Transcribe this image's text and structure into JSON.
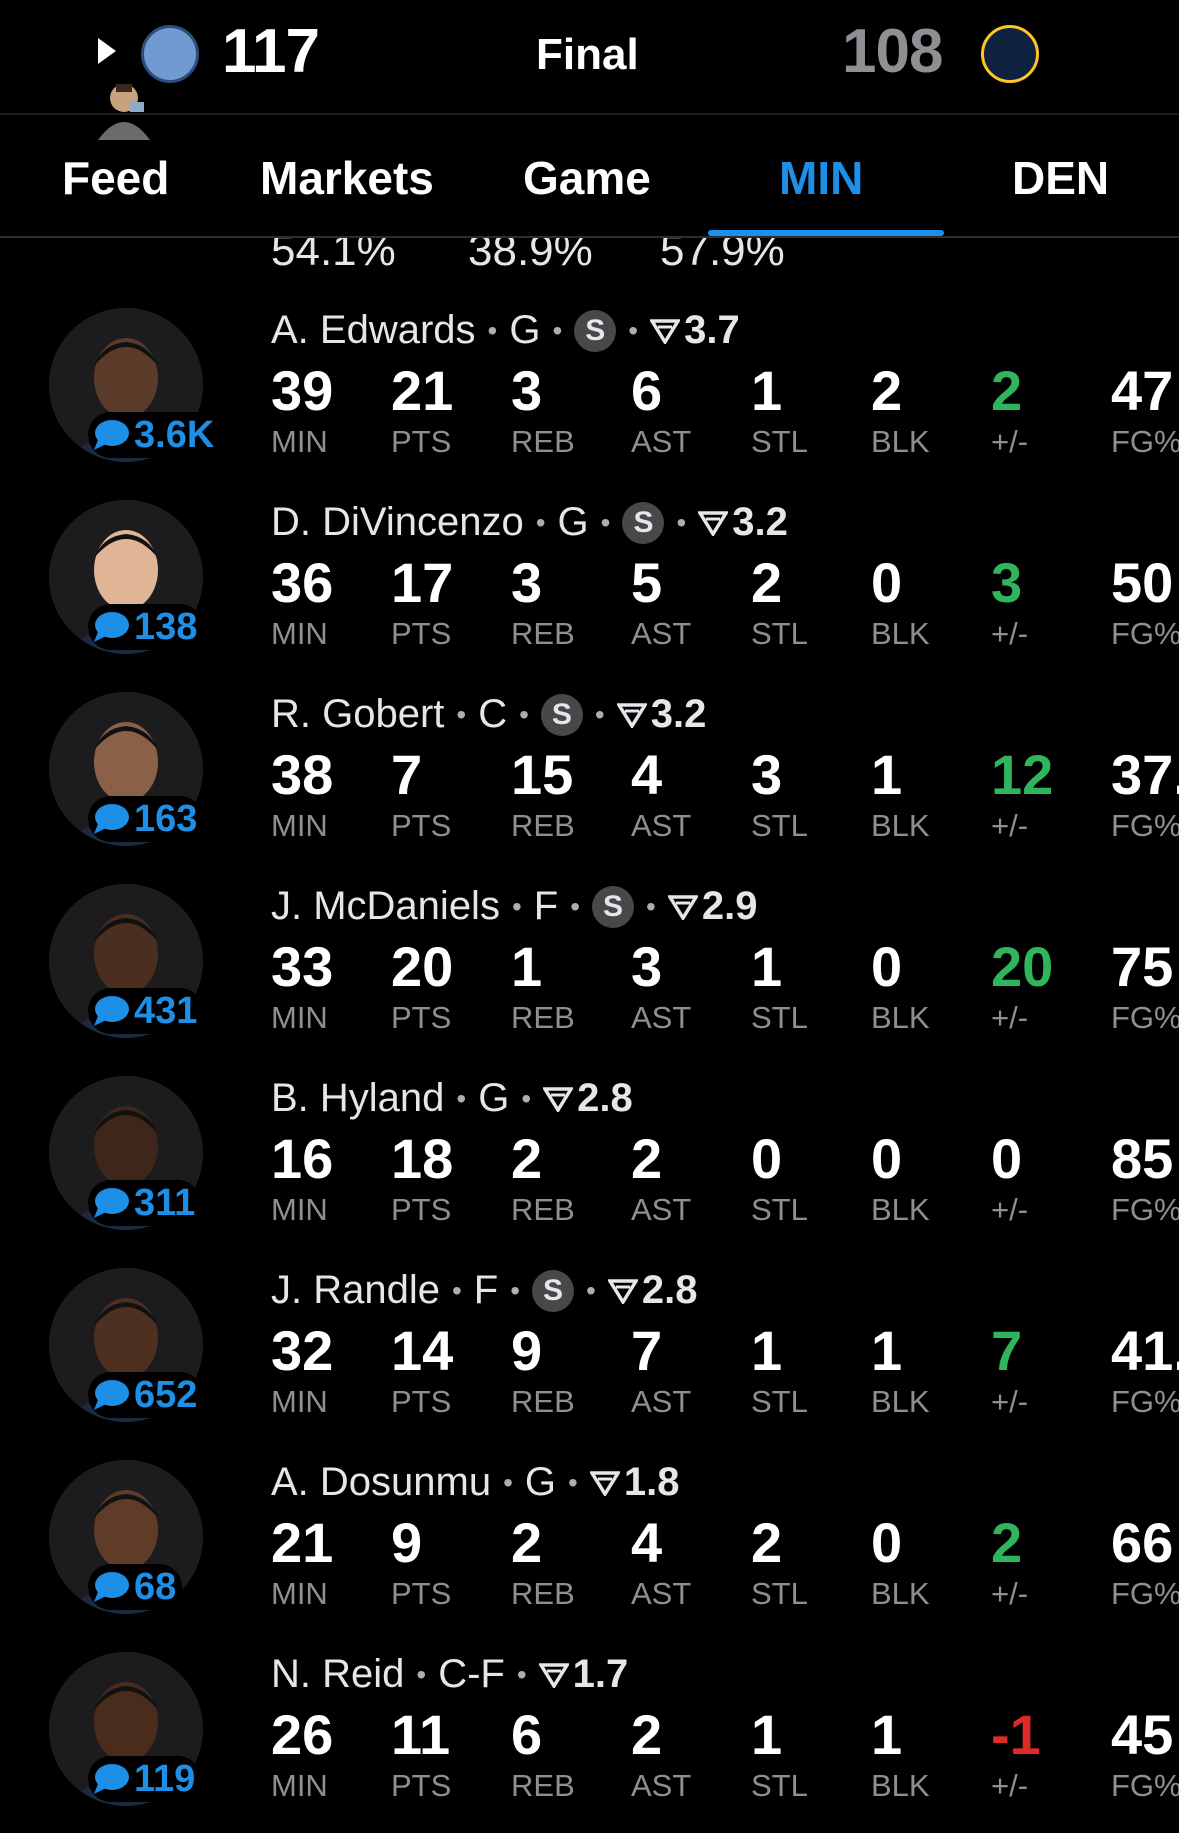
{
  "header": {
    "home_score": "117",
    "status": "Final",
    "away_score": "108"
  },
  "tabs": [
    {
      "label": "Feed",
      "active": false
    },
    {
      "label": "Markets",
      "active": false
    },
    {
      "label": "Game",
      "active": false
    },
    {
      "label": "MIN",
      "active": true
    },
    {
      "label": "DEN",
      "active": false
    }
  ],
  "totals": [
    "54.1%",
    "38.9%",
    "57.9%"
  ],
  "stat_labels": [
    "MIN",
    "PTS",
    "REB",
    "AST",
    "STL",
    "BLK",
    "+/-",
    "FG%"
  ],
  "colors": {
    "accent": "#1e8fe6",
    "positive": "#30b45c",
    "negative": "#e02a2a"
  },
  "players": [
    {
      "name": "A. Edwards",
      "pos": "G",
      "starter": true,
      "rating": "3.7",
      "comments": "3.6K",
      "stats": [
        "39",
        "21",
        "3",
        "6",
        "1",
        "2",
        "2",
        "47"
      ],
      "pm_sign": "pos"
    },
    {
      "name": "D. DiVincenzo",
      "pos": "G",
      "starter": true,
      "rating": "3.2",
      "comments": "138",
      "stats": [
        "36",
        "17",
        "3",
        "5",
        "2",
        "0",
        "3",
        "50"
      ],
      "pm_sign": "pos"
    },
    {
      "name": "R. Gobert",
      "pos": "C",
      "starter": true,
      "rating": "3.2",
      "comments": "163",
      "stats": [
        "38",
        "7",
        "15",
        "4",
        "3",
        "1",
        "12",
        "37."
      ],
      "pm_sign": "pos"
    },
    {
      "name": "J. McDaniels",
      "pos": "F",
      "starter": true,
      "rating": "2.9",
      "comments": "431",
      "stats": [
        "33",
        "20",
        "1",
        "3",
        "1",
        "0",
        "20",
        "75"
      ],
      "pm_sign": "pos"
    },
    {
      "name": "B. Hyland",
      "pos": "G",
      "starter": false,
      "rating": "2.8",
      "comments": "311",
      "stats": [
        "16",
        "18",
        "2",
        "2",
        "0",
        "0",
        "0",
        "85"
      ],
      "pm_sign": "zero"
    },
    {
      "name": "J. Randle",
      "pos": "F",
      "starter": true,
      "rating": "2.8",
      "comments": "652",
      "stats": [
        "32",
        "14",
        "9",
        "7",
        "1",
        "1",
        "7",
        "41."
      ],
      "pm_sign": "pos"
    },
    {
      "name": "A. Dosunmu",
      "pos": "G",
      "starter": false,
      "rating": "1.8",
      "comments": "68",
      "stats": [
        "21",
        "9",
        "2",
        "4",
        "2",
        "0",
        "2",
        "66"
      ],
      "pm_sign": "pos"
    },
    {
      "name": "N. Reid",
      "pos": "C-F",
      "starter": false,
      "rating": "1.7",
      "comments": "119",
      "stats": [
        "26",
        "11",
        "6",
        "2",
        "1",
        "1",
        "-1",
        "45"
      ],
      "pm_sign": "neg"
    }
  ]
}
